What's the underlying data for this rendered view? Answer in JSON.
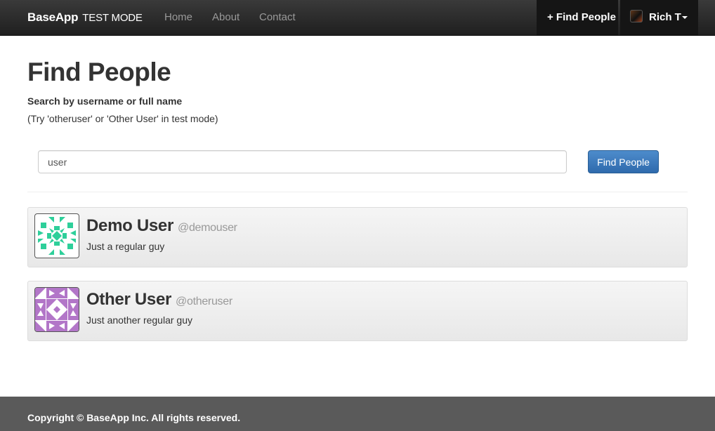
{
  "navbar": {
    "brand": "BaseApp",
    "mode": "TEST MODE",
    "links": [
      "Home",
      "About",
      "Contact"
    ],
    "find_people": "+ Find People",
    "user_name": "Rich T"
  },
  "page": {
    "title": "Find People",
    "search_label": "Search by username or full name",
    "hint": "(Try 'otheruser' or 'Other User' in test mode)"
  },
  "search": {
    "value": "user",
    "button_label": "Find People"
  },
  "results": [
    {
      "name": "Demo User",
      "username": "@demouser",
      "bio": "Just a regular guy",
      "color": "#2ecf9a"
    },
    {
      "name": "Other User",
      "username": "@otheruser",
      "bio": "Just another regular guy",
      "color": "#b276c8"
    }
  ],
  "footer": {
    "copyright": "Copyright © BaseApp Inc. All rights reserved."
  }
}
